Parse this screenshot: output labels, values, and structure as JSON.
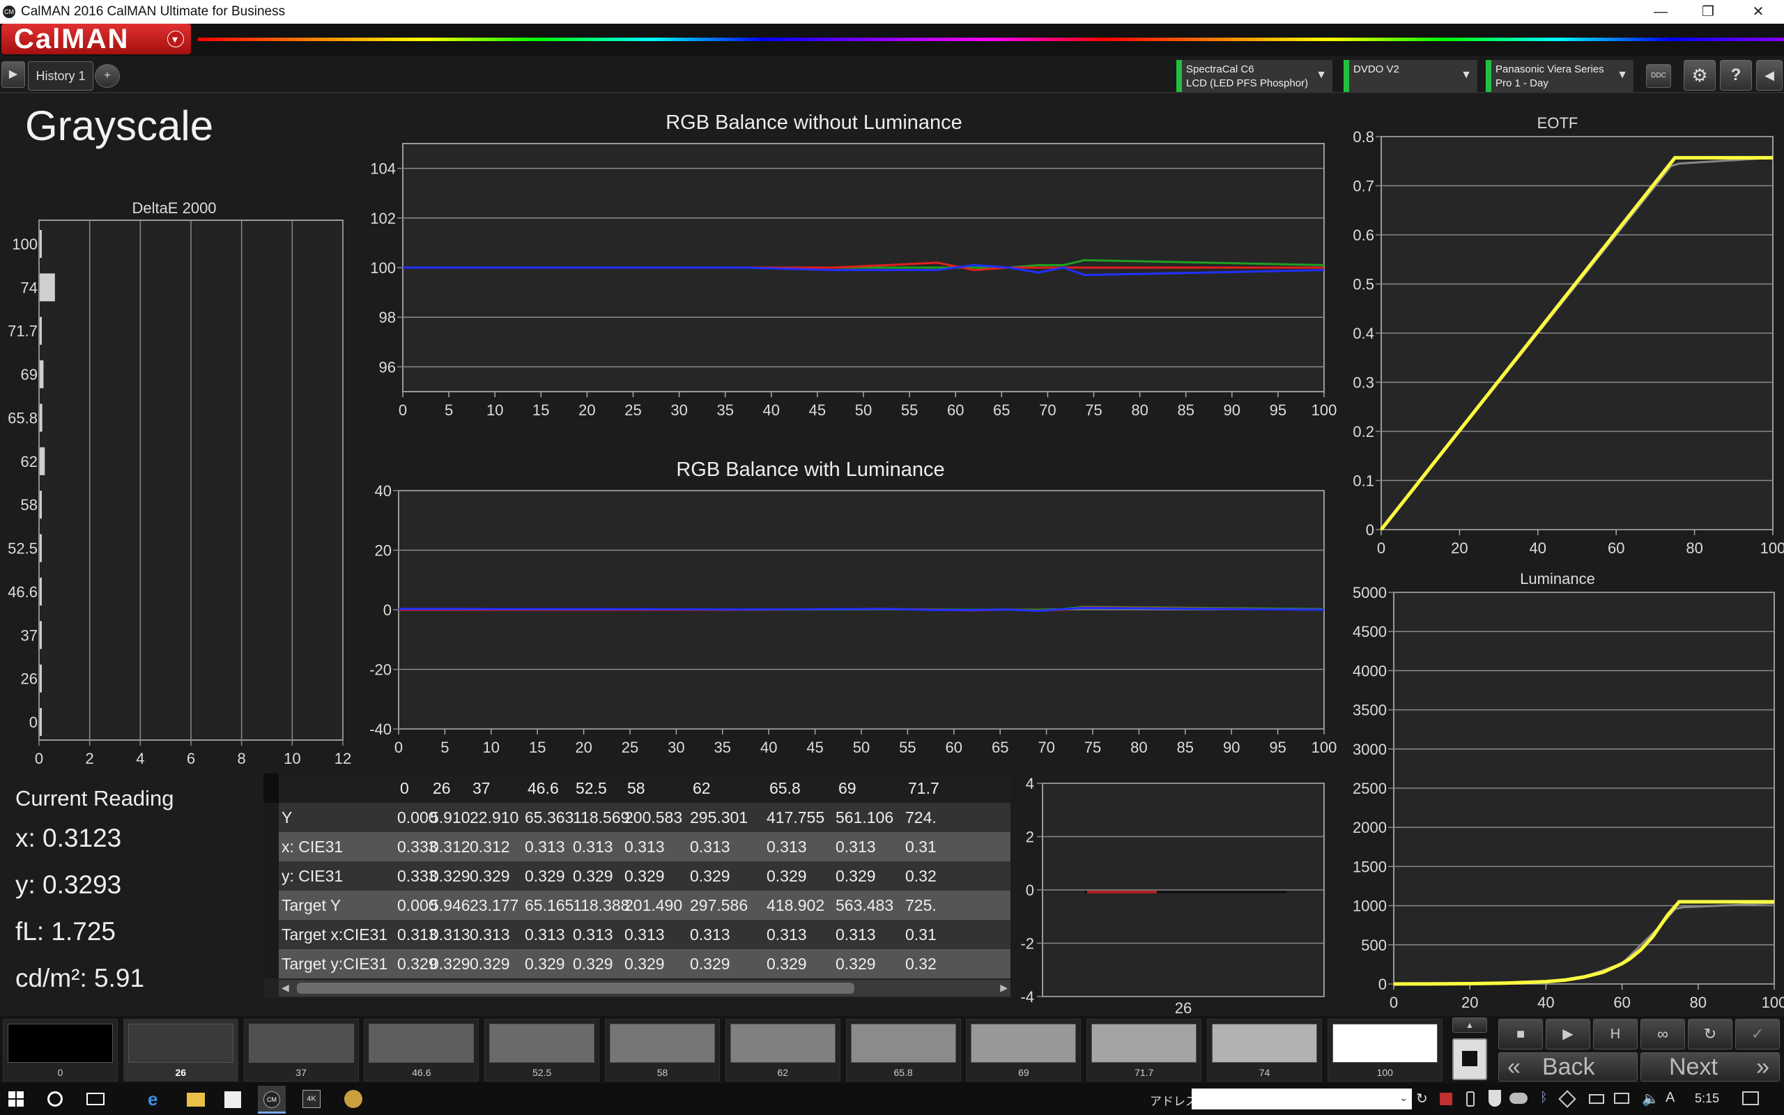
{
  "window": {
    "title": "CalMAN 2016 CalMAN Ultimate for Business",
    "app_icon": "CM",
    "minimize_glyph": "—",
    "maximize_glyph": "❐",
    "close_glyph": "✕"
  },
  "logo": {
    "text": "CalMAN",
    "menu_glyph": "▾"
  },
  "tabs": {
    "play_glyph": "▶",
    "history_label": "History 1",
    "add_glyph": "+"
  },
  "devices": {
    "meter": {
      "line1": "SpectraCal C6",
      "line2": "LCD (LED PFS Phosphor)"
    },
    "generator": {
      "line1": "DVDO V2",
      "line2": ""
    },
    "display": {
      "line1": "Panasonic Viera Series",
      "line2": "Pro 1 - Day"
    },
    "ddc_label": "DDC",
    "settings_glyph": "⚙",
    "help_glyph": "?",
    "collapse_glyph": "◀"
  },
  "page": {
    "title": "Grayscale"
  },
  "deltae": {
    "title": "DeltaE 2000",
    "categories": [
      "100",
      "74",
      "71.7",
      "69",
      "65.8",
      "62",
      "58",
      "52.5",
      "46.6",
      "37",
      "26",
      "0"
    ],
    "values": [
      0,
      0.6,
      0.05,
      0.15,
      0.1,
      0.2,
      0.05,
      0.05,
      0.05,
      0.05,
      0.05,
      0.05
    ],
    "x_ticks": [
      "0",
      "2",
      "4",
      "6",
      "8",
      "10",
      "12"
    ],
    "xlim": [
      0,
      12
    ]
  },
  "rgb_no_lum": {
    "title": "RGB Balance without Luminance",
    "y_ticks": [
      "104",
      "102",
      "100",
      "98",
      "96"
    ],
    "x_ticks": [
      "0",
      "5",
      "10",
      "15",
      "20",
      "25",
      "30",
      "35",
      "40",
      "45",
      "50",
      "55",
      "60",
      "65",
      "70",
      "75",
      "80",
      "85",
      "90",
      "95",
      "100"
    ],
    "ylim": [
      95,
      105
    ],
    "x": [
      0,
      26,
      37,
      46.6,
      52.5,
      58,
      62,
      65.8,
      69,
      71.7,
      74,
      100
    ],
    "red": [
      100.0,
      100.0,
      100.0,
      100.0,
      100.1,
      100.2,
      99.9,
      100.0,
      100.0,
      100.0,
      100.0,
      100.0
    ],
    "green": [
      100.0,
      100.0,
      100.0,
      100.0,
      100.0,
      100.0,
      100.0,
      100.0,
      100.1,
      100.1,
      100.3,
      100.1
    ],
    "blue": [
      100.0,
      100.0,
      100.0,
      99.9,
      99.9,
      99.9,
      100.1,
      100.0,
      99.8,
      100.0,
      99.7,
      99.9
    ]
  },
  "rgb_lum": {
    "title": "RGB Balance with Luminance",
    "y_ticks": [
      "40",
      "20",
      "0",
      "-20",
      "-40"
    ],
    "x_ticks": [
      "0",
      "5",
      "10",
      "15",
      "20",
      "25",
      "30",
      "35",
      "40",
      "45",
      "50",
      "55",
      "60",
      "65",
      "70",
      "75",
      "80",
      "85",
      "90",
      "95",
      "100"
    ],
    "ylim": [
      -40,
      40
    ],
    "x": [
      0,
      26,
      37,
      46.6,
      52.5,
      58,
      62,
      65.8,
      69,
      71.7,
      74,
      100
    ],
    "red": [
      0.0,
      0.0,
      0.0,
      0.2,
      0.3,
      0.0,
      -0.2,
      0.1,
      -0.3,
      0.0,
      0.8,
      0.0
    ],
    "green": [
      0.0,
      0.0,
      0.0,
      0.1,
      0.2,
      0.1,
      0.0,
      0.1,
      0.0,
      0.2,
      1.0,
      0.2
    ],
    "blue": [
      0.3,
      0.2,
      0.1,
      0.2,
      0.3,
      -0.1,
      -0.1,
      0.1,
      -0.4,
      0.2,
      0.6,
      0.0
    ]
  },
  "eotf": {
    "title": "EOTF",
    "y_ticks": [
      "0.8",
      "0.7",
      "0.6",
      "0.5",
      "0.4",
      "0.3",
      "0.2",
      "0.1",
      "0"
    ],
    "x_ticks": [
      "0",
      "20",
      "40",
      "60",
      "80",
      "100"
    ],
    "ylim": [
      0,
      0.8
    ],
    "target": {
      "x": [
        0,
        75,
        100
      ],
      "y": [
        0,
        0.757,
        0.757
      ]
    },
    "measured": {
      "x": [
        0,
        74,
        76,
        100
      ],
      "y": [
        0,
        0.74,
        0.745,
        0.757
      ]
    }
  },
  "luminance": {
    "title": "Luminance",
    "y_ticks": [
      "5000",
      "4500",
      "4000",
      "3500",
      "3000",
      "2500",
      "2000",
      "1500",
      "1000",
      "500",
      "0"
    ],
    "x_ticks": [
      "0",
      "20",
      "40",
      "60",
      "80",
      "100"
    ],
    "ylim": [
      0,
      5000
    ],
    "target": {
      "x": [
        0,
        10,
        20,
        30,
        40,
        45,
        50,
        55,
        60,
        62,
        65,
        68,
        70,
        72,
        75,
        100
      ],
      "y": [
        0,
        1,
        4,
        12,
        30,
        50,
        90,
        150,
        260,
        320,
        440,
        600,
        740,
        880,
        1050,
        1050
      ]
    },
    "measured": {
      "x": [
        0,
        10,
        20,
        30,
        40,
        50,
        60,
        70,
        74,
        76,
        100
      ],
      "y": [
        0,
        1,
        4,
        12,
        30,
        90,
        260,
        740,
        960,
        980,
        1030
      ]
    }
  },
  "current_reading": {
    "title": "Current Reading",
    "x": "x: 0.3123",
    "y": "y: 0.3293",
    "fl": "fL: 1.725",
    "cdm2": "cd/m²: 5.91"
  },
  "table": {
    "columns": [
      "0",
      "26",
      "37",
      "46.6",
      "52.5",
      "58",
      "62",
      "65.8",
      "69",
      "71.7"
    ],
    "rows": [
      {
        "label": "Y",
        "values": [
          "0.000",
          "5.910",
          "22.910",
          "65.363",
          "118.569",
          "200.583",
          "295.301",
          "417.755",
          "561.106",
          "724."
        ]
      },
      {
        "label": "x: CIE31",
        "values": [
          "0.333",
          "0.312",
          "0.312",
          "0.313",
          "0.313",
          "0.313",
          "0.313",
          "0.313",
          "0.313",
          "0.31"
        ]
      },
      {
        "label": "y: CIE31",
        "values": [
          "0.333",
          "0.329",
          "0.329",
          "0.329",
          "0.329",
          "0.329",
          "0.329",
          "0.329",
          "0.329",
          "0.32"
        ]
      },
      {
        "label": "Target Y",
        "values": [
          "0.000",
          "5.946",
          "23.177",
          "65.165",
          "118.388",
          "201.490",
          "297.586",
          "418.902",
          "563.483",
          "725."
        ]
      },
      {
        "label": "Target x:CIE31",
        "values": [
          "0.313",
          "0.313",
          "0.313",
          "0.313",
          "0.313",
          "0.313",
          "0.313",
          "0.313",
          "0.313",
          "0.31"
        ]
      },
      {
        "label": "Target y:CIE31",
        "values": [
          "0.329",
          "0.329",
          "0.329",
          "0.329",
          "0.329",
          "0.329",
          "0.329",
          "0.329",
          "0.329",
          "0.32"
        ]
      }
    ],
    "scroll_left_glyph": "◀",
    "scroll_right_glyph": "▶"
  },
  "small_chart": {
    "y_ticks": [
      "4",
      "2",
      "0",
      "-2",
      "-4"
    ],
    "x_label": "26",
    "ylim": [
      -4,
      4
    ],
    "bar_value": -0.05,
    "bar_color": "#b02020"
  },
  "swatches": [
    {
      "label": "0",
      "color": "#000000"
    },
    {
      "label": "26",
      "color": "#3a3a3a"
    },
    {
      "label": "37",
      "color": "#505050"
    },
    {
      "label": "46.6",
      "color": "#5e5e5e"
    },
    {
      "label": "52.5",
      "color": "#6a6a6a"
    },
    {
      "label": "58",
      "color": "#767676"
    },
    {
      "label": "62",
      "color": "#808080"
    },
    {
      "label": "65.8",
      "color": "#8b8b8b"
    },
    {
      "label": "69",
      "color": "#989898"
    },
    {
      "label": "71.7",
      "color": "#a4a4a4"
    },
    {
      "label": "74",
      "color": "#b2b2b2"
    },
    {
      "label": "100",
      "color": "#ffffff"
    }
  ],
  "controls": {
    "back_label": "Back",
    "next_label": "Next",
    "back_glyph": "«",
    "next_glyph": "»",
    "stop_glyph": "■",
    "play_glyph": "▶",
    "record_glyph": "H",
    "loop_glyph": "∞",
    "refresh_glyph": "↻",
    "check_glyph": "✓",
    "up_glyph": "▲"
  },
  "taskbar": {
    "address_label": "アドレス",
    "clock": "5:15",
    "ime_glyph": "A"
  },
  "colors": {
    "red_series": "#e02020",
    "green_series": "#20a020",
    "blue_series": "#2030ff",
    "eotf_target": "#ffff40",
    "eotf_measured": "#888888",
    "accent_green": "#22c040"
  }
}
